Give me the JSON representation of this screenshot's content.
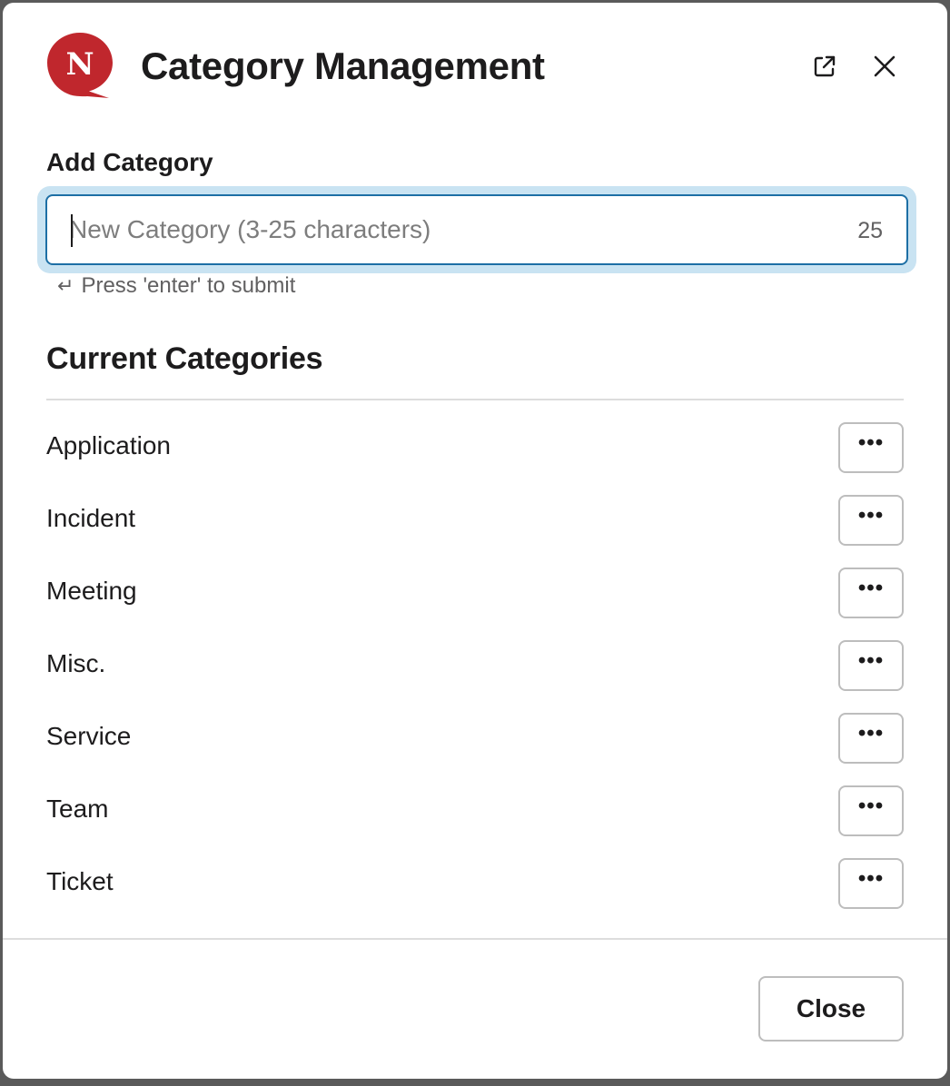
{
  "header": {
    "logo_letter": "N",
    "title": "Category Management",
    "popout_icon": "external-link-icon",
    "close_icon": "close-icon"
  },
  "add_section": {
    "label": "Add Category",
    "input_value": "",
    "input_placeholder": "New Category (3-25 characters)",
    "char_count": "25",
    "hint_icon": "↵",
    "hint_text": "Press 'enter' to submit"
  },
  "current_section": {
    "title": "Current Categories",
    "categories": [
      {
        "name": "Application",
        "action": "•••"
      },
      {
        "name": "Incident",
        "action": "•••"
      },
      {
        "name": "Meeting",
        "action": "•••"
      },
      {
        "name": "Misc.",
        "action": "•••"
      },
      {
        "name": "Service",
        "action": "•••"
      },
      {
        "name": "Team",
        "action": "•••"
      },
      {
        "name": "Ticket",
        "action": "•••"
      }
    ]
  },
  "footer": {
    "close_label": "Close"
  },
  "colors": {
    "logo_red": "#c0272d",
    "focus_ring": "#c9e3f2",
    "focus_border": "#1d6fa5"
  }
}
